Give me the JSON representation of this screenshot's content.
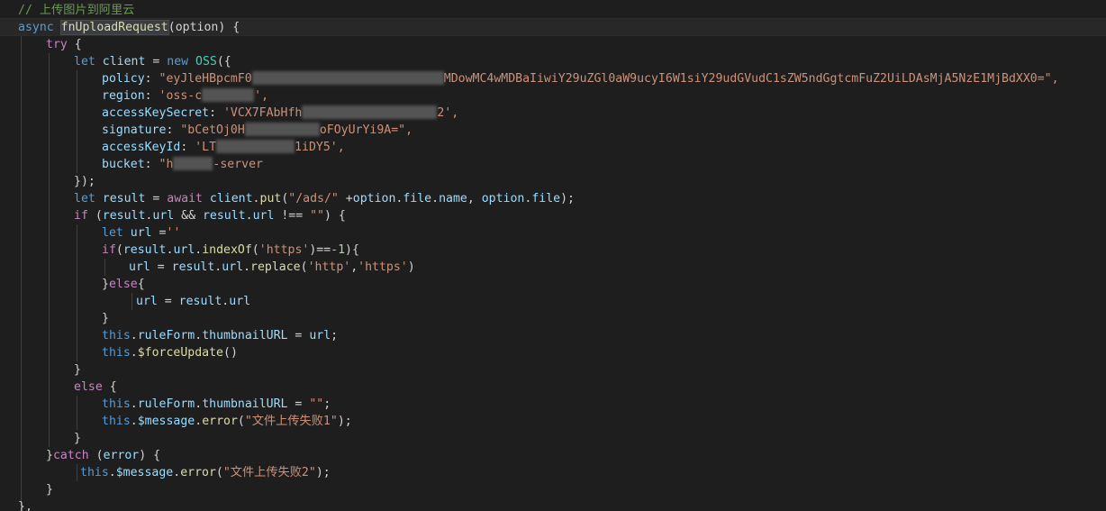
{
  "code": {
    "comment": "// 上传图片到阿里云",
    "async_kw": "async",
    "fn_name": "fnUploadRequest",
    "fn_params": "(option) {",
    "try_kw": "try",
    "try_open": " {",
    "let_kw": "let",
    "client_var": "client",
    "eq_new": " = ",
    "new_kw": "new",
    "oss_cls": "OSS",
    "oss_open": "({",
    "policy_key": "policy",
    "policy_val_start": "\"eyJleHBpcmF0",
    "policy_val_end": "MDowMC4wMDBaIiwiY29uZGl0aW9ucyI6W1siY29udGVudC1sZW5ndGgtcmFuZ2UiLDAsMjA5NzE1MjBdXX0=\",",
    "region_key": "region",
    "region_val_start": "'oss-c",
    "region_val_end": "',",
    "aks_key": "accessKeySecret",
    "aks_val_start": "'VCX7FAbHfh",
    "aks_val_end": "2',",
    "sig_key": "signature",
    "sig_val_start": "\"bCetOj0H",
    "sig_val_end": "oFOyUrYi9A=\",",
    "akid_key": "accessKeyId",
    "akid_val_start": "'LT",
    "akid_val_end": "1iDY5',",
    "bucket_key": "bucket",
    "bucket_val_start": "\"h",
    "bucket_val_end": "-server",
    "oss_close": "});",
    "result_var": "result",
    "await_kw": "await",
    "put_call": "put",
    "ads_path": "\"/ads/\"",
    "option_var": "option",
    "file_prop": "file",
    "name_prop": "name",
    "if_kw": "if",
    "url_prop": "url",
    "empty_str": "\"\"",
    "url_var": "url",
    "empty_single": "''",
    "indexof_fn": "indexOf",
    "https_str": "'https'",
    "num_minus_one": "-1",
    "replace_fn": "replace",
    "http_str": "'http'",
    "else_kw": "else",
    "this_kw": "this",
    "ruleform_prop": "ruleForm",
    "thumb_prop": "thumbnailURL",
    "force_update": "$forceUpdate",
    "message_prop": "$message",
    "error_fn": "error",
    "fail_msg_1": "\"文件上传失败1\"",
    "catch_kw": "catch",
    "error_var": "error",
    "fail_msg_2": "\"文件上传失败2\"",
    "final_close": "},"
  }
}
